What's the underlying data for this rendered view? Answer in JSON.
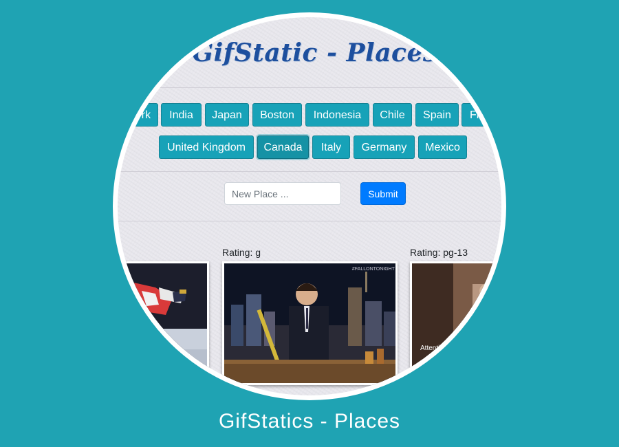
{
  "header": {
    "title": "GifStatic - Places"
  },
  "places_row1": [
    "rk",
    "India",
    "Japan",
    "Boston",
    "Indonesia",
    "Chile",
    "Spain",
    "Fr"
  ],
  "places_row2": [
    "United Kingdom",
    "Canada",
    "Italy",
    "Germany",
    "Mexico"
  ],
  "active_place": "Canada",
  "form": {
    "placeholder": "New Place ...",
    "submit_label": "Submit"
  },
  "gifs": [
    {
      "rating": "",
      "overlay_text": ""
    },
    {
      "rating": "Rating: g",
      "overlay_text": "#FALLONTONIGHT"
    },
    {
      "rating": "Rating: pg-13",
      "overlay_text": "Attention here"
    }
  ],
  "caption": "GifStatics - Places",
  "colors": {
    "background": "#1fa3b3",
    "place_button": "#17a2b8",
    "submit_button": "#007bff",
    "title": "#1d4f9e"
  }
}
